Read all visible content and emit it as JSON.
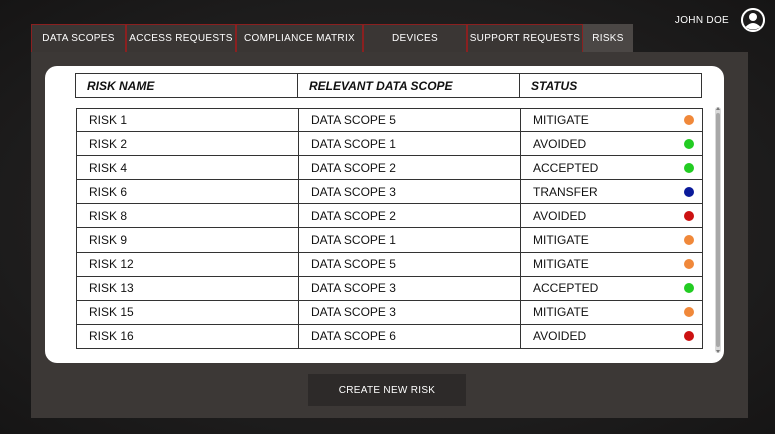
{
  "user": {
    "name": "JOHN DOE",
    "avatar_icon": "user-circle-icon"
  },
  "tabs": [
    {
      "label": "DATA SCOPES"
    },
    {
      "label": "ACCESS REQUESTS"
    },
    {
      "label": "COMPLIANCE MATRIX"
    },
    {
      "label": "DEVICES"
    },
    {
      "label": "SUPPORT REQUESTS"
    },
    {
      "label": "RISKS",
      "active": true
    }
  ],
  "table": {
    "headers": [
      "RISK NAME",
      "RELEVANT DATA SCOPE",
      "STATUS"
    ],
    "rows": [
      {
        "name": "RISK 1",
        "scope": "DATA SCOPE 5",
        "status": "MITIGATE",
        "color": "#f0883a"
      },
      {
        "name": "RISK 2",
        "scope": "DATA SCOPE 1",
        "status": "AVOIDED",
        "color": "#22cc22"
      },
      {
        "name": "RISK 4",
        "scope": "DATA SCOPE 2",
        "status": "ACCEPTED",
        "color": "#22cc22"
      },
      {
        "name": "RISK 6",
        "scope": "DATA SCOPE 3",
        "status": "TRANSFER",
        "color": "#0a1a9a"
      },
      {
        "name": "RISK 8",
        "scope": "DATA SCOPE 2",
        "status": "AVOIDED",
        "color": "#cc1111"
      },
      {
        "name": "RISK 9",
        "scope": "DATA SCOPE 1",
        "status": "MITIGATE",
        "color": "#f0883a"
      },
      {
        "name": "RISK 12",
        "scope": "DATA SCOPE 5",
        "status": "MITIGATE",
        "color": "#f0883a"
      },
      {
        "name": "RISK 13",
        "scope": "DATA SCOPE 3",
        "status": "ACCEPTED",
        "color": "#22cc22"
      },
      {
        "name": "RISK 15",
        "scope": "DATA SCOPE 3",
        "status": "MITIGATE",
        "color": "#f0883a"
      },
      {
        "name": "RISK 16",
        "scope": "DATA SCOPE 6",
        "status": "AVOIDED",
        "color": "#cc1111"
      }
    ]
  },
  "actions": {
    "create_label": "CREATE NEW RISK"
  }
}
